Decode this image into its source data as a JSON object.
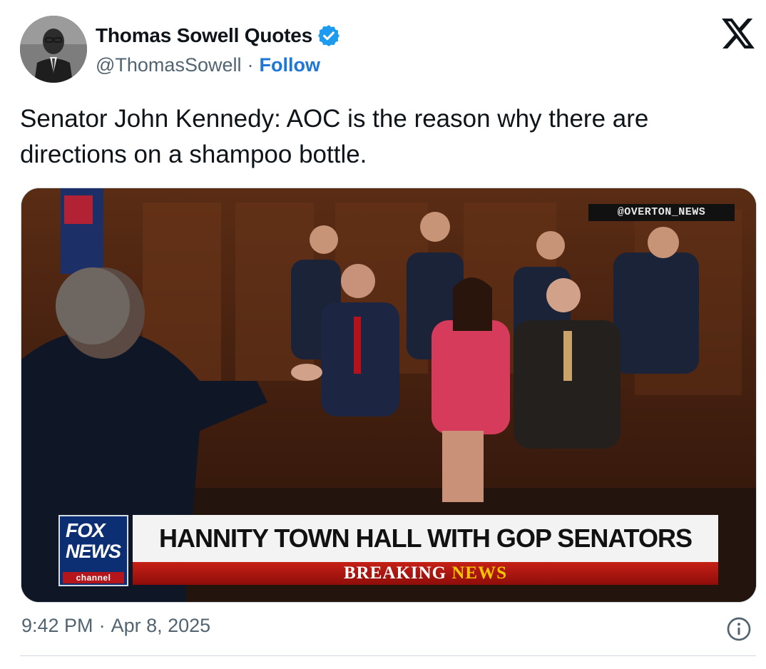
{
  "author": {
    "display_name": "Thomas Sowell Quotes",
    "handle": "@ThomasSowell",
    "separator": "·",
    "follow_label": "Follow",
    "verified": true,
    "verified_color": "#1d9bf0"
  },
  "tweet": {
    "text": "Senator John Kennedy: AOC is the reason why there are directions on a shampoo bottle."
  },
  "media": {
    "watermark": "@OVERTON_NEWS",
    "network_logo": {
      "top": "FOX",
      "middle": "NEWS",
      "bottom": "channel"
    },
    "headline": "HANNITY TOWN HALL WITH GOP SENATORS",
    "breaking_prefix": "BREAKING",
    "breaking_suffix": "NEWS"
  },
  "footer": {
    "time": "9:42 PM",
    "separator": "·",
    "date": "Apr 8, 2025"
  },
  "icons": {
    "platform": "x-logo-icon",
    "info": "info-icon",
    "verified": "verified-badge-icon"
  },
  "colors": {
    "text_primary": "#0f1419",
    "text_secondary": "#536471",
    "link": "#1d76d8",
    "border": "#cfd9de"
  }
}
